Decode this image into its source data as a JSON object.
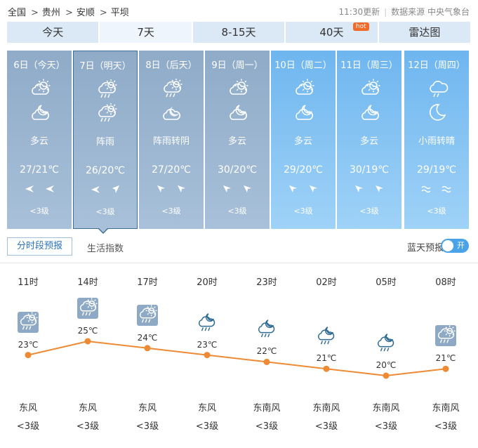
{
  "breadcrumb": [
    "全国",
    "贵州",
    "安顺",
    "平坝"
  ],
  "breadcrumb_sep": ">",
  "meta": {
    "updated": "11:30更新",
    "source": "数据来源 中央气象台"
  },
  "tabs": [
    {
      "label": "今天",
      "active": false
    },
    {
      "label": "7天",
      "active": true
    },
    {
      "label": "8-15天",
      "active": false
    },
    {
      "label": "40天",
      "active": false,
      "badge": "hot"
    },
    {
      "label": "雷达图",
      "active": false
    }
  ],
  "days": [
    {
      "title": "6日（今天）",
      "weather": "多云",
      "temp": "27/21℃",
      "level": "<3级",
      "icon1": "partly-cloudy-icon",
      "icon2": "cloudy-night-icon",
      "wind": [
        "west-wind-icon",
        "west-wind-icon"
      ],
      "state": "past"
    },
    {
      "title": "7日（明天）",
      "weather": "阵雨",
      "temp": "26/20℃",
      "level": "<3级",
      "icon1": "shower-rain-icon",
      "icon2": "shower-rain-icon",
      "wind": [
        "west-wind-icon",
        "northeast-wind-icon"
      ],
      "state": "selected"
    },
    {
      "title": "8日（后天）",
      "weather": "阵雨转阴",
      "temp": "27/20℃",
      "level": "<3级",
      "icon1": "shower-rain-icon",
      "icon2": "moon-cloud-icon",
      "wind": [
        "northwest-wind-icon",
        "northwest-wind-icon"
      ],
      "state": "past"
    },
    {
      "title": "9日（周一）",
      "weather": "多云",
      "temp": "30/20℃",
      "level": "<3级",
      "icon1": "partly-cloudy-icon",
      "icon2": "cloudy-night-icon",
      "wind": [
        "northwest-wind-icon",
        "northwest-wind-icon"
      ],
      "state": "past"
    },
    {
      "title": "10日（周二）",
      "weather": "多云",
      "temp": "29/20℃",
      "level": "<3级",
      "icon1": "partly-cloudy-icon",
      "icon2": "cloudy-night-icon",
      "wind": [
        "northwest-wind-icon",
        "northwest-wind-icon"
      ],
      "state": "future"
    },
    {
      "title": "11日（周三）",
      "weather": "多云",
      "temp": "30/19℃",
      "level": "<3级",
      "icon1": "partly-cloudy-icon",
      "icon2": "cloudy-night-icon",
      "wind": [
        "northwest-wind-icon",
        "northwest-wind-icon"
      ],
      "state": "future"
    },
    {
      "title": "12日（周四）",
      "weather": "小雨转晴",
      "temp": "29/19℃",
      "level": "<3级",
      "icon1": "light-rain-icon",
      "icon2": "moon-icon",
      "wind": [
        "breeze-icon",
        "breeze-icon"
      ],
      "state": "future"
    }
  ],
  "subtabs": {
    "hourly": "分时段预报",
    "life": "生活指数"
  },
  "skyforecast": {
    "label": "蓝天预报",
    "toggle": "开"
  },
  "hourly": [
    {
      "time": "11时",
      "temp": "23℃",
      "value": 23,
      "wind": "东风",
      "level": "<3级",
      "icon": "shower-rain-icon",
      "tile": true
    },
    {
      "time": "14时",
      "temp": "25℃",
      "value": 25,
      "wind": "东风",
      "level": "<3级",
      "icon": "shower-rain-icon",
      "tile": true
    },
    {
      "time": "17时",
      "temp": "24℃",
      "value": 24,
      "wind": "东风",
      "level": "<3级",
      "icon": "shower-rain-icon",
      "tile": true
    },
    {
      "time": "20时",
      "temp": "23℃",
      "value": 23,
      "wind": "东风",
      "level": "<3级",
      "icon": "night-shower-icon",
      "tile": false
    },
    {
      "time": "23时",
      "temp": "22℃",
      "value": 22,
      "wind": "东南风",
      "level": "<3级",
      "icon": "night-shower-icon",
      "tile": false
    },
    {
      "time": "02时",
      "temp": "21℃",
      "value": 21,
      "wind": "东南风",
      "level": "<3级",
      "icon": "night-shower-icon",
      "tile": false
    },
    {
      "time": "05时",
      "temp": "20℃",
      "value": 20,
      "wind": "东南风",
      "level": "<3级",
      "icon": "night-shower-icon",
      "tile": false
    },
    {
      "time": "08时",
      "temp": "21℃",
      "value": 21,
      "wind": "东南风",
      "level": "<3级",
      "icon": "shower-rain-icon",
      "tile": true
    }
  ],
  "colors": {
    "line": "#ee8a33",
    "tab": "#dbe9f7",
    "past_card": "#8fabc8",
    "future_card": "#6fb6ef",
    "hot": "#f06a2a",
    "toggle": "#4aa3e8",
    "night_icon": "#2f6b93"
  }
}
